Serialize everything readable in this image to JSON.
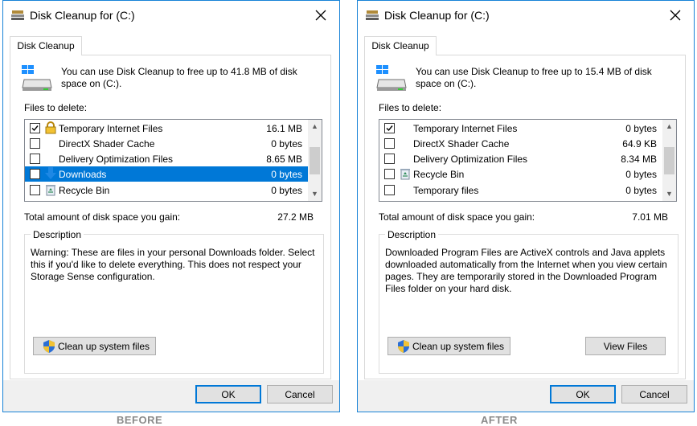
{
  "before": {
    "window_title": "Disk Cleanup for  (C:)",
    "tab_label": "Disk Cleanup",
    "intro_text": "You can use Disk Cleanup to free up to 41.8 MB of disk space on  (C:).",
    "files_label": "Files to delete:",
    "files": [
      {
        "name": "Temporary Internet Files",
        "size": "16.1 MB",
        "checked": true,
        "icon": "lock-icon"
      },
      {
        "name": "DirectX Shader Cache",
        "size": "0 bytes",
        "checked": false,
        "icon": "none"
      },
      {
        "name": "Delivery Optimization Files",
        "size": "8.65 MB",
        "checked": false,
        "icon": "none"
      },
      {
        "name": "Downloads",
        "size": "0 bytes",
        "checked": false,
        "icon": "download-arrow-icon",
        "selected": true
      },
      {
        "name": "Recycle Bin",
        "size": "0 bytes",
        "checked": false,
        "icon": "recycle-bin-icon"
      }
    ],
    "total_label": "Total amount of disk space you gain:",
    "total_value": "27.2 MB",
    "description_label": "Description",
    "description_text": "Warning: These are files in your personal Downloads folder. Select this if you'd like to delete everything. This does not respect your Storage Sense configuration.",
    "cleanup_system_label": "Clean up system files",
    "ok_label": "OK",
    "cancel_label": "Cancel",
    "caption": "BEFORE"
  },
  "after": {
    "window_title": "Disk Cleanup for  (C:)",
    "tab_label": "Disk Cleanup",
    "intro_text": "You can use Disk Cleanup to free up to 15.4 MB of disk space on  (C:).",
    "files_label": "Files to delete:",
    "files": [
      {
        "name": "Temporary Internet Files",
        "size": "0 bytes",
        "checked": true,
        "icon": "none"
      },
      {
        "name": "DirectX Shader Cache",
        "size": "64.9 KB",
        "checked": false,
        "icon": "none"
      },
      {
        "name": "Delivery Optimization Files",
        "size": "8.34 MB",
        "checked": false,
        "icon": "none"
      },
      {
        "name": "Recycle Bin",
        "size": "0 bytes",
        "checked": false,
        "icon": "recycle-bin-icon"
      },
      {
        "name": "Temporary files",
        "size": "0 bytes",
        "checked": false,
        "icon": "none"
      }
    ],
    "total_label": "Total amount of disk space you gain:",
    "total_value": "7.01 MB",
    "description_label": "Description",
    "description_text": "Downloaded Program Files are ActiveX controls and Java applets downloaded automatically from the Internet when you view certain pages. They are temporarily stored in the Downloaded Program Files folder on your hard disk.",
    "cleanup_system_label": "Clean up system files",
    "view_files_label": "View Files",
    "ok_label": "OK",
    "cancel_label": "Cancel",
    "caption": "AFTER"
  },
  "colors": {
    "window_border": "#1883d7",
    "selection": "#0078d7",
    "footer_bg": "#f0f0f0",
    "button_bg": "#e1e1e1"
  }
}
